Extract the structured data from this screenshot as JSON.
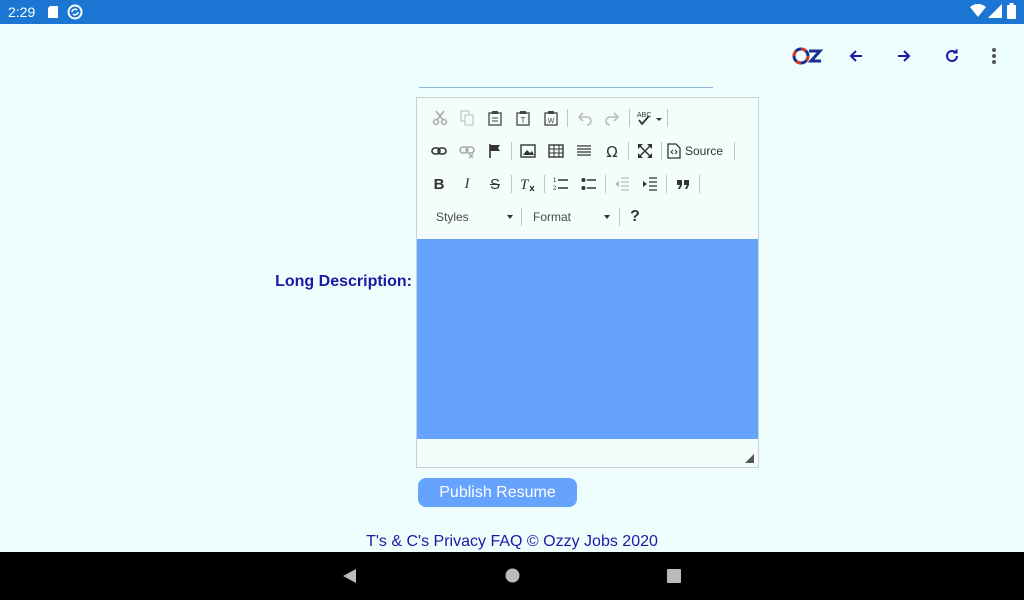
{
  "status_bar": {
    "time": "2:29",
    "icons": [
      "sd-card-icon",
      "sync-icon",
      "wifi-icon",
      "signal-icon",
      "battery-icon"
    ]
  },
  "app_bar": {
    "logo_text": "OZ",
    "buttons": [
      "back-icon",
      "forward-icon",
      "refresh-icon",
      "more-icon"
    ]
  },
  "editor": {
    "row1": [
      "cut",
      "copy",
      "paste",
      "paste-text",
      "paste-word",
      "undo",
      "redo",
      "spellcheck"
    ],
    "row2": [
      "link",
      "unlink",
      "anchor",
      "image",
      "table",
      "horizontal-line",
      "special-char",
      "maximize"
    ],
    "source_label": "Source",
    "row3": [
      "bold",
      "italic",
      "strike",
      "remove-format",
      "numbered-list",
      "bulleted-list",
      "outdent",
      "indent",
      "blockquote"
    ],
    "styles_label": "Styles",
    "format_label": "Format",
    "help_label": "?"
  },
  "form": {
    "long_description_label": "Long Description:",
    "publish_button": "Publish Resume"
  },
  "footer": {
    "terms": "T's & C's",
    "privacy": "Privacy",
    "faq": "FAQ",
    "copyright": "© Ozzy Jobs 2020"
  },
  "colors": {
    "status_bar": "#1a76d2",
    "background": "#eefefd",
    "accent_blue": "#66a3ff",
    "label_text": "#1a1aa6"
  }
}
